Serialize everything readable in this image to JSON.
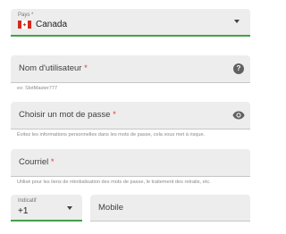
{
  "country": {
    "label": "Pays *",
    "value": "Canada",
    "flag_icon": "canada-flag-icon",
    "flag_color": "#d52b1e"
  },
  "username": {
    "placeholder": "Nom d'utilisateur",
    "required_mark": "*",
    "helper": "ex: SlotMaster777",
    "icon": "help-icon",
    "icon_glyph": "?"
  },
  "password": {
    "placeholder": "Choisir un mot de passe",
    "required_mark": "*",
    "helper": "Évitez les informations personnelles dans les mots de passe, cela vous met à risque.",
    "icon": "eye-icon"
  },
  "email": {
    "placeholder": "Courriel",
    "required_mark": "*",
    "helper": "Utilisé pour les liens de réinitialisation des mots de passe, le traitement des retraits, etc."
  },
  "phone": {
    "code_label": "Indicatif",
    "code_value": "+1",
    "mobile_placeholder": "Mobile"
  },
  "colors": {
    "active_underline": "#43a047",
    "required": "#e53935",
    "field_bg": "#ededed"
  }
}
